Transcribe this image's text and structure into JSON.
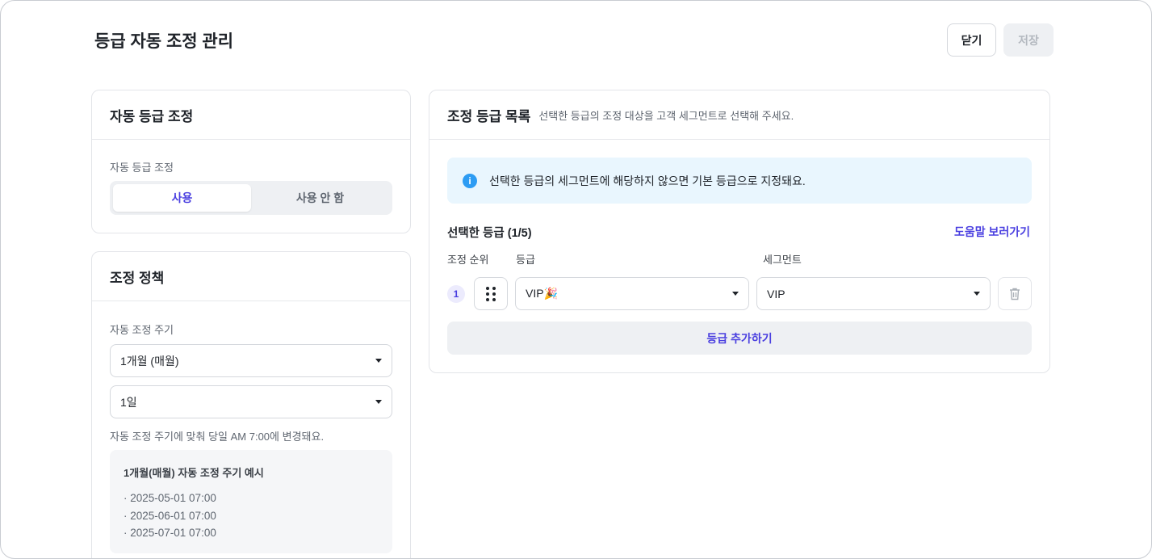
{
  "page": {
    "title": "등급 자동 조정 관리"
  },
  "header": {
    "close_label": "닫기",
    "save_label": "저장"
  },
  "auto_card": {
    "title": "자동 등급 조정",
    "field_label": "자동 등급 조정",
    "options": [
      "사용",
      "사용 안 함"
    ],
    "selected": "사용"
  },
  "policy_card": {
    "title": "조정 정책",
    "field_label": "자동 조정 주기",
    "period_value": "1개월 (매월)",
    "day_value": "1일",
    "note": "자동 조정 주기에 맞춰 당일 AM 7:00에 변경돼요.",
    "example_title": "1개월(매월) 자동 조정 주기 예시",
    "example_items": [
      "· 2025-05-01 07:00",
      "· 2025-06-01 07:00",
      "· 2025-07-01 07:00"
    ]
  },
  "list_card": {
    "title": "조정 등급 목록",
    "subtitle": "선택한 등급의 조정 대상을 고객 세그먼트로 선택해 주세요.",
    "info_text": "선택한 등급의 세그먼트에 해당하지 않으면 기본 등급으로 지정돼요.",
    "selected_title": "선택한 등급 (1/5)",
    "help_link": "도움말 보러가기",
    "columns": {
      "order": "조정 순위",
      "grade": "등급",
      "segment": "세그먼트"
    },
    "rows": [
      {
        "order": "1",
        "grade": "VIP🎉",
        "segment": "VIP"
      }
    ],
    "add_label": "등급 추가하기"
  },
  "colors": {
    "accent": "#4a3fe0",
    "info_bg": "#e9f6fe",
    "info_icon": "#2d9cf3"
  },
  "icons": [
    "info-icon",
    "drag-handle-icon",
    "trash-icon",
    "caret-down-icon"
  ]
}
